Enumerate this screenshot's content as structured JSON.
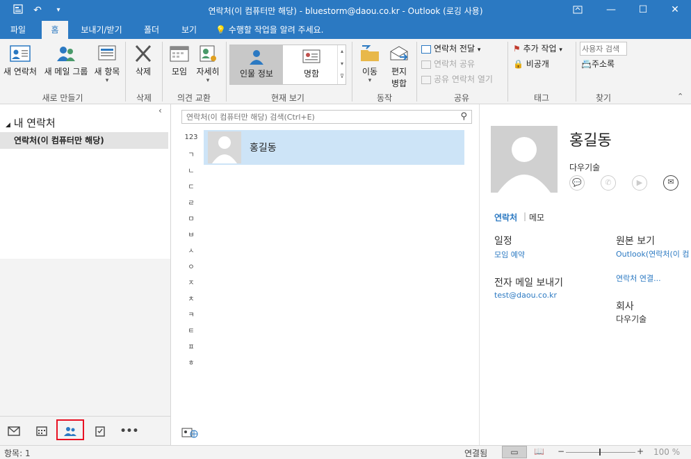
{
  "window": {
    "title": "연락처(이 컴퓨터만 해당) - bluestorm@daou.co.kr - Outlook (로깅 사용)",
    "controls": [
      "restore-ribbon",
      "minimize",
      "maximize",
      "close"
    ]
  },
  "tabs": [
    {
      "label": "파일"
    },
    {
      "label": "홈",
      "active": true
    },
    {
      "label": "보내기/받기"
    },
    {
      "label": "폴더"
    },
    {
      "label": "보기"
    }
  ],
  "tell_me": "수행할 작업을 알려 주세요.",
  "ribbon": {
    "new_contact": "새 연락처",
    "new_group": "새 메일 그룹",
    "new_items": "새 항목",
    "group_new": "새로 만들기",
    "delete": "삭제",
    "group_delete": "삭제",
    "meeting": "모임",
    "more": "자세히",
    "group_comm": "의견 교환",
    "view_people": "인물 정보",
    "view_card": "명함",
    "group_view": "현재 보기",
    "move": "이동",
    "merge_line1": "편지",
    "merge_line2": "병합",
    "group_actions": "동작",
    "forward_contact": "연락처 전달",
    "share_contacts": "연락처 공유",
    "open_shared": "공유 연락처 열기",
    "group_share": "공유",
    "followup": "추가 작업",
    "private": "비공개",
    "group_tags": "태그",
    "search_people_placeholder": "사용자 검색",
    "address_book": "주소록",
    "group_find": "찾기"
  },
  "nav": {
    "section": "내 연락처",
    "folder": "연락처(이 컴퓨터만 해당)"
  },
  "search": {
    "placeholder": "연락처(이 컴퓨터만 해당) 검색(Ctrl+E)"
  },
  "index": [
    "123",
    "ㄱ",
    "ㄴ",
    "ㄷ",
    "ㄹ",
    "ㅁ",
    "ㅂ",
    "ㅅ",
    "ㅇ",
    "ㅈ",
    "ㅊ",
    "ㅋ",
    "ㅌ",
    "ㅍ",
    "ㅎ"
  ],
  "contacts": [
    {
      "name": "홍길동"
    }
  ],
  "card": {
    "name": "홍길동",
    "company": "다우기술",
    "tab_contact": "연락처",
    "tab_notes": "메모",
    "schedule_title": "일정",
    "schedule_link": "모임 예약",
    "email_title": "전자 메일 보내기",
    "email": "test@daou.co.kr",
    "source_title": "원본 보기",
    "source_value": "Outlook(연락처(이 컴",
    "link_contacts": "연락처 연결...",
    "company_title": "회사",
    "company_value": "다우기술"
  },
  "status": {
    "items": "항목: 1",
    "connection": "연결됨",
    "zoom": "100 %"
  },
  "colors": {
    "accent": "#2b79c2",
    "selection": "#cde4f7",
    "highlight_box": "#e81123"
  }
}
